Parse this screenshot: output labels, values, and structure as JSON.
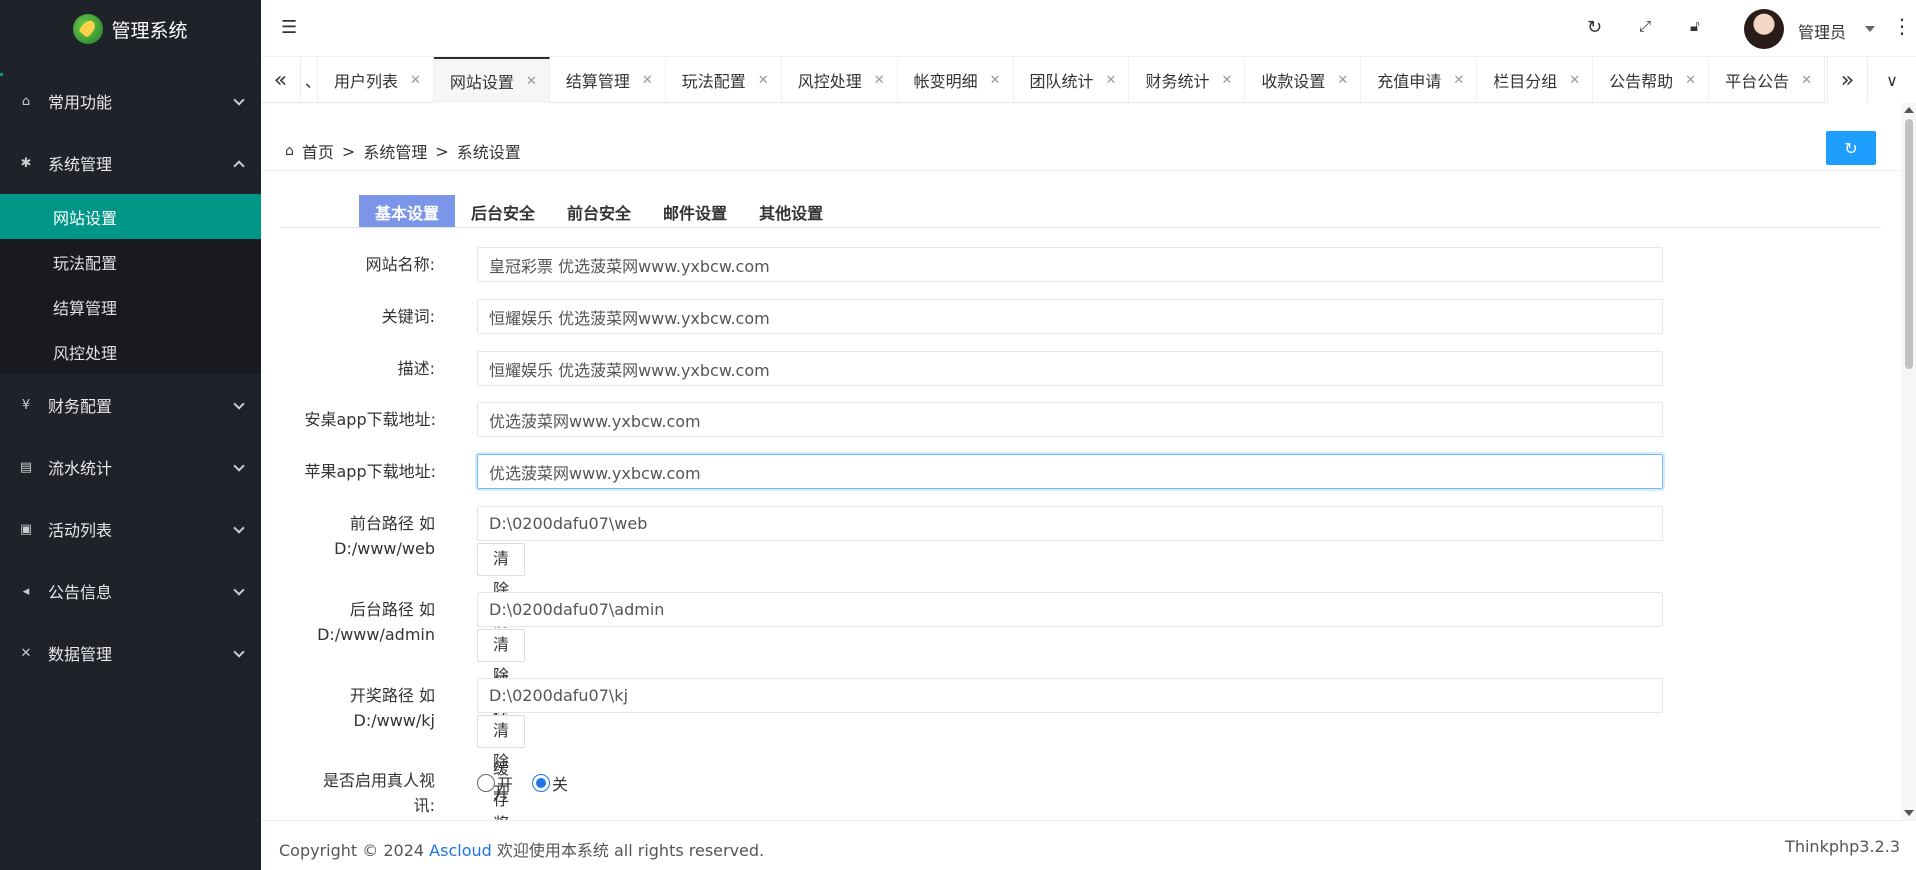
{
  "app": {
    "title": "管理系统"
  },
  "sidebar": {
    "groups": [
      {
        "label": "常用功能",
        "icon": "home-icon"
      },
      {
        "label": "系统管理",
        "icon": "gear-icon",
        "expanded": true,
        "items": [
          {
            "label": "网站设置",
            "active": true
          },
          {
            "label": "玩法配置"
          },
          {
            "label": "结算管理"
          },
          {
            "label": "风控处理"
          }
        ]
      },
      {
        "label": "财务配置",
        "icon": "yen-icon"
      },
      {
        "label": "流水统计",
        "icon": "clipboard-icon"
      },
      {
        "label": "活动列表",
        "icon": "gift-icon"
      },
      {
        "label": "公告信息",
        "icon": "speaker-icon"
      },
      {
        "label": "数据管理",
        "icon": "tools-icon"
      }
    ]
  },
  "header": {
    "user": "管理员"
  },
  "tabs": {
    "stub": "、",
    "items": [
      "用户列表",
      "网站设置",
      "结算管理",
      "玩法配置",
      "风控处理",
      "帐变明细",
      "团队统计",
      "财务统计",
      "收款设置",
      "充值申请",
      "栏目分组",
      "公告帮助",
      "平台公告"
    ],
    "active": "网站设置"
  },
  "breadcrumb": {
    "home": "首页",
    "sep": ">",
    "level1": "系统管理",
    "level2": "系统设置"
  },
  "form_tabs": [
    "基本设置",
    "后台安全",
    "前台安全",
    "邮件设置",
    "其他设置"
  ],
  "form": {
    "site_name": {
      "label": "网站名称:",
      "value": "皇冠彩票 优选菠菜网www.yxbcw.com"
    },
    "keywords": {
      "label": "关键词:",
      "value": "恒耀娱乐 优选菠菜网www.yxbcw.com"
    },
    "description": {
      "label": "描述:",
      "value": "恒耀娱乐 优选菠菜网www.yxbcw.com"
    },
    "android_url": {
      "label": "安桌app下载地址:",
      "value": "优选菠菜网www.yxbcw.com"
    },
    "ios_url": {
      "label": "苹果app下载地址:",
      "value": "优选菠菜网www.yxbcw.com"
    },
    "front_path": {
      "label_line1": "前台路径 如",
      "label_line2": "D:/www/web",
      "value": "D:\\0200dafu07\\web",
      "button": "清除前台缓存"
    },
    "admin_path": {
      "label_line1": "后台路径 如",
      "label_line2": "D:/www/admin",
      "value": "D:\\0200dafu07\\admin",
      "button": "清除后台缓存"
    },
    "draw_path": {
      "label_line1": "开奖路径 如",
      "label_line2": "D:/www/kj",
      "value": "D:\\0200dafu07\\kj",
      "button": "清除开奖器缓存"
    },
    "live_video": {
      "label_line1": "是否启用真人视",
      "label_line2": "讯:",
      "on_label": "开",
      "off_label": "关",
      "selected": "off"
    }
  },
  "footer": {
    "copyright_prefix": "Copyright © 2024",
    "brand": "Ascloud",
    "copyright_suffix": "欢迎使用本系统 all rights reserved.",
    "version": "Thinkphp3.2.3"
  },
  "colors": {
    "sidebar_bg": "#20222a",
    "active_menu": "#009688",
    "form_tab_active": "#7b96e8",
    "primary_button": "#1e9fff"
  }
}
